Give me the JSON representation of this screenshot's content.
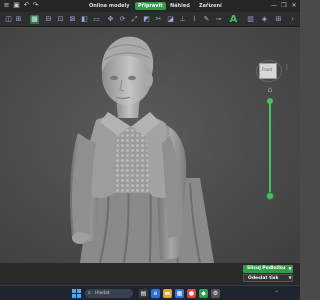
{
  "menubar": {
    "tabs": [
      {
        "label": "Online modely",
        "active": false
      },
      {
        "label": "Připravit",
        "active": true
      },
      {
        "label": "Náhled",
        "active": false
      },
      {
        "label": "Zařízení",
        "active": false
      }
    ],
    "window_controls": [
      "—",
      "❐",
      "✕"
    ]
  },
  "viewport": {
    "nav_cube_face": "Front"
  },
  "actions": {
    "print_label": "Slicuj Podložku",
    "send_label": "Odeslat tisk"
  },
  "taskbar": {
    "search_placeholder": "Hledat",
    "tray_text": "^"
  },
  "colors": {
    "accent": "#2e9e4c",
    "toolbar_bg": "#2e2e2e",
    "viewport_bg": "#4b4b4b",
    "taskbar_bg": "#1f2530"
  },
  "icons": {
    "toolbar": [
      "open-icon",
      "save-icon",
      "undo-icon",
      "redo-icon",
      "cube-icon",
      "move-icon",
      "grid-icon",
      "rotate-icon",
      "scale-icon",
      "layout-icon",
      "cut-icon",
      "split-icon",
      "support-icon",
      "paint-icon",
      "seam-icon",
      "measure-icon",
      "text-icon",
      "variable-icon",
      "arrange-icon"
    ]
  }
}
